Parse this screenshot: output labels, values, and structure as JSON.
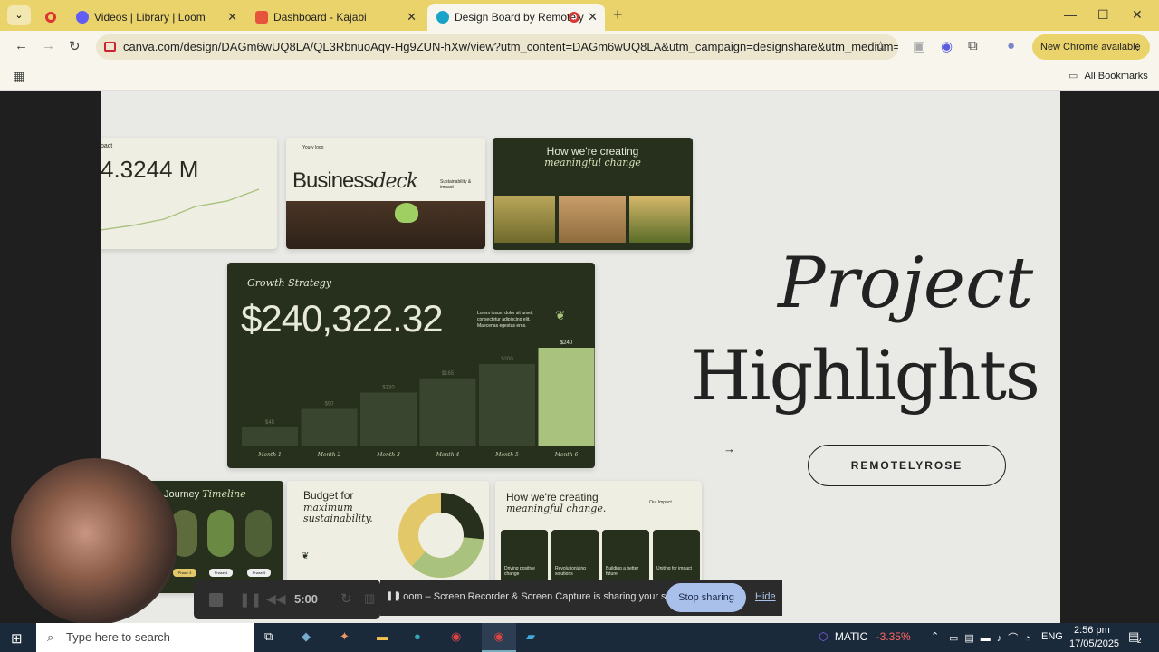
{
  "tabs": [
    {
      "label": ""
    },
    {
      "label": "Videos | Library | Loom"
    },
    {
      "label": "Dashboard - Kajabi"
    },
    {
      "label": "Design Board by Remotely"
    }
  ],
  "url": "canva.com/design/DAGm6wUQ8LA/QL3RbnuoAqv-Hg9ZUN-hXw/view?utm_content=DAGm6wUQ8LA&utm_campaign=designshare&utm_medium=link2&u...",
  "new_chrome": "New Chrome available",
  "all_bookmarks": "All Bookmarks",
  "card_metric": {
    "value": "4.3244 M",
    "prefix": "pact"
  },
  "card_business": {
    "brand": "Youry logo",
    "title_a": "Business",
    "title_b": "deck",
    "sub": "Sustainability & impact"
  },
  "card_meaningful_top": {
    "line1": "How we're creating",
    "line2": "meaningful change"
  },
  "growth": {
    "title": "Growth Strategy",
    "amount": "$240,322.32",
    "blurb": "Lorem ipsum dolor sit amet, consectetur adipiscing elit. Maecenas egestas eros.",
    "chart_data": {
      "type": "bar",
      "categories": [
        "Month 1",
        "Month 2",
        "Month 3",
        "Month 4",
        "Month 5",
        "Month 6"
      ],
      "values": [
        45,
        90,
        130,
        165,
        200,
        240
      ],
      "value_labels": [
        "$45",
        "$90",
        "$130",
        "$165",
        "$200",
        "$240"
      ],
      "ylim": [
        0,
        240
      ]
    }
  },
  "title_line1": "Project",
  "title_line2": "Highlights",
  "cta": "REMOTELYROSE",
  "journey": {
    "a": "Journey",
    "b": "Timeline",
    "phases": [
      "Phase 3",
      "Phase 4",
      "Phase 5"
    ]
  },
  "budget": {
    "l1": "Budget for",
    "l2": "maximum",
    "l3": "sustainability."
  },
  "meaningful_bottom": {
    "l1": "How we're creating",
    "l2": "meaningful change.",
    "badge": "Our Impact",
    "tiles": [
      "Driving positive change",
      "Revolutionizing solutions",
      "Building a better future",
      "Uniting for impact"
    ]
  },
  "recorder": {
    "time": "5:00"
  },
  "loom_notice": "Loom – Screen Recorder & Screen Capture is sharing your screen.",
  "stop_sharing": "Stop sharing",
  "hide": "Hide",
  "taskbar": {
    "search_placeholder": "Type here to search",
    "ticker": "MATIC",
    "ticker_change": "-3.35%",
    "lang": "ENG",
    "time": "2:56 pm",
    "date": "17/05/2025",
    "notif": "2"
  }
}
